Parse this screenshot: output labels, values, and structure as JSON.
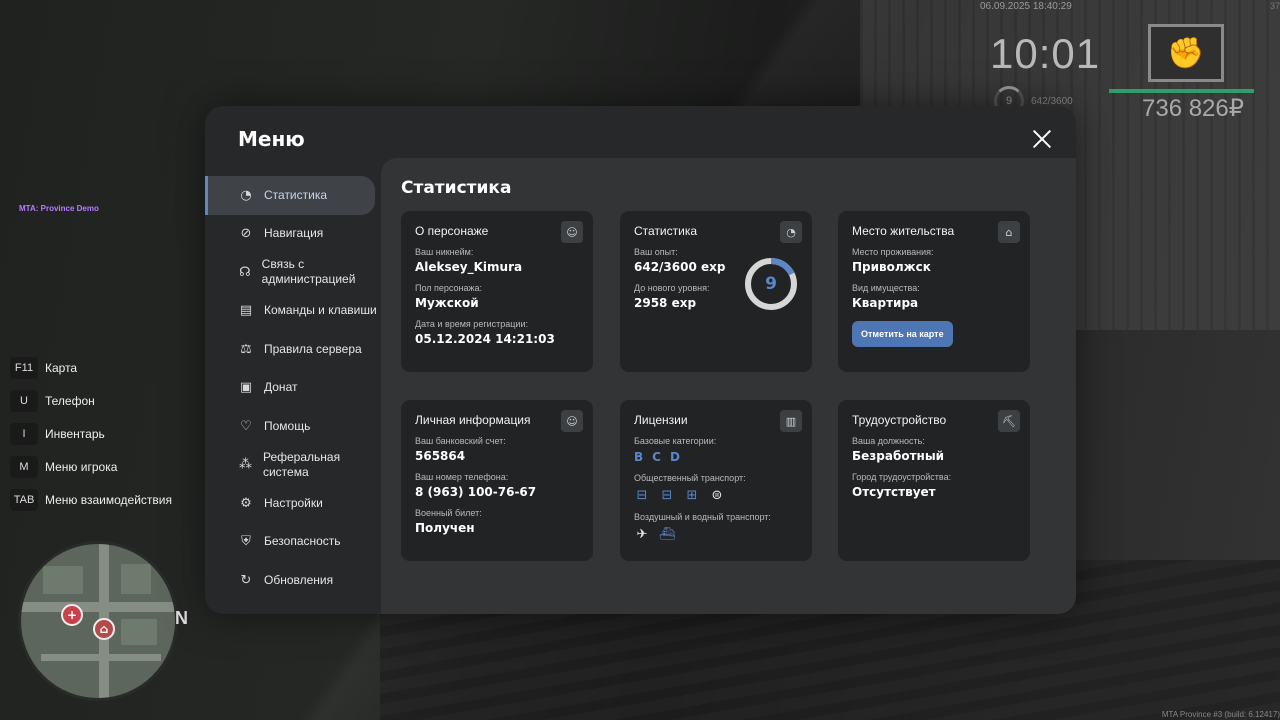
{
  "hud": {
    "datetime": "06.09.2025 18:40:29",
    "corner_num": "37",
    "time": "10:01",
    "level": "9",
    "exp": "642/3600",
    "health": 1.0,
    "money": "736 826₽",
    "server_label": "MTA: Province Demo",
    "build_info": "MTA Province #3 (build: 6.12417)",
    "north": "N",
    "keys": [
      {
        "key": "F11",
        "label": "Карта"
      },
      {
        "key": "U",
        "label": "Телефон"
      },
      {
        "key": "I",
        "label": "Инвентарь"
      },
      {
        "key": "M",
        "label": "Меню игрока"
      },
      {
        "key": "TAB",
        "label": "Меню взаимодействия"
      }
    ],
    "colors": {
      "accent": "#5c86c7",
      "health": "#2f9e6d",
      "server_label": "#b57cff"
    }
  },
  "menu": {
    "title": "Меню",
    "nav": [
      {
        "label": "Статистика",
        "icon": "pie-chart-icon",
        "active": true
      },
      {
        "label": "Навигация",
        "icon": "compass-icon"
      },
      {
        "label": "Связь с администрацией",
        "icon": "headset-icon"
      },
      {
        "label": "Команды и клавиши",
        "icon": "document-icon"
      },
      {
        "label": "Правила сервера",
        "icon": "scales-icon"
      },
      {
        "label": "Донат",
        "icon": "wallet-icon"
      },
      {
        "label": "Помощь",
        "icon": "heart-hand-icon"
      },
      {
        "label": "Реферальная система",
        "icon": "network-icon"
      },
      {
        "label": "Настройки",
        "icon": "gear-icon"
      },
      {
        "label": "Безопасность",
        "icon": "shield-icon"
      },
      {
        "label": "Обновления",
        "icon": "refresh-check-icon"
      }
    ]
  },
  "stats": {
    "title": "Статистика",
    "character": {
      "title": "О персонаже",
      "nickname_label": "Ваш никнейм:",
      "nickname": "Aleksey_Kimura",
      "gender_label": "Пол персонажа:",
      "gender": "Мужской",
      "reg_label": "Дата и время регистрации:",
      "reg": "05.12.2024 14:21:03"
    },
    "statistics": {
      "title": "Статистика",
      "exp_label": "Ваш опыт:",
      "exp": "642/3600 exp",
      "next_label": "До нового уровня:",
      "next": "2958 exp",
      "level": "9",
      "level_progress": 0.178
    },
    "residence": {
      "title": "Место жительства",
      "place_label": "Место проживания:",
      "place": "Приволжск",
      "property_label": "Вид имущества:",
      "property": "Квартира",
      "button": "Отметить на карте"
    },
    "personal": {
      "title": "Личная информация",
      "bank_label": "Ваш банковский счет:",
      "bank": "565864",
      "phone_label": "Ваш номер телефона:",
      "phone": "8 (963) 100-76-67",
      "military_label": "Военный билет:",
      "military": "Получен"
    },
    "licenses": {
      "title": "Лицензии",
      "basic_label": "Базовые категории:",
      "basic": [
        "B",
        "C",
        "D"
      ],
      "public_label": "Общественный транспорт:",
      "public_icons": [
        "bus-icon",
        "bus-icon",
        "tram-icon",
        "subway-icon"
      ],
      "air_label": "Воздушный и водный транспорт:",
      "air_icons": [
        "plane-icon",
        "boat-icon"
      ]
    },
    "employment": {
      "title": "Трудоустройство",
      "position_label": "Ваша должность:",
      "position": "Безработный",
      "city_label": "Город трудоустройства:",
      "city": "Отсутствует"
    }
  }
}
